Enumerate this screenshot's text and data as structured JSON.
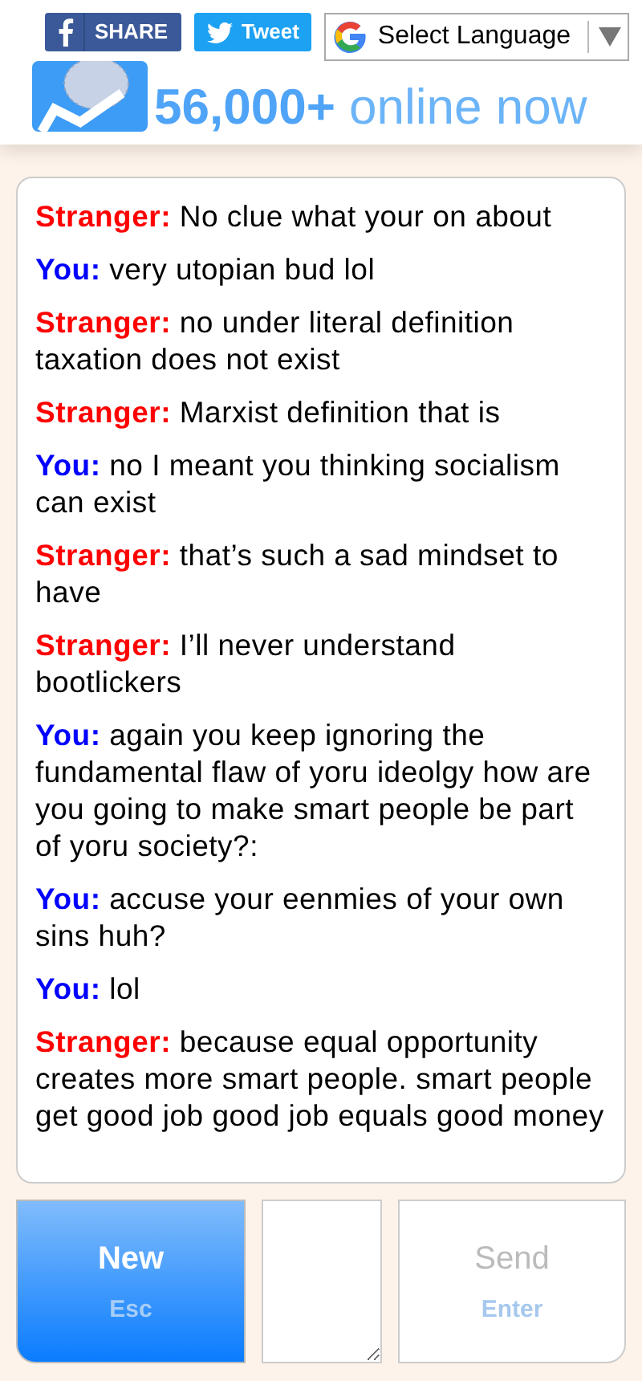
{
  "header": {
    "share_buttons": [
      {
        "kind": "facebook",
        "label": "SHARE"
      },
      {
        "kind": "twitter",
        "label": "Tweet"
      }
    ],
    "language_select": {
      "value": "Select Language"
    },
    "online_count": {
      "count": "56,000+",
      "label": "online now"
    }
  },
  "messages": [
    {
      "kind": "stranger",
      "speaker": "Stranger:",
      "text": "No clue what your on about"
    },
    {
      "kind": "you",
      "speaker": "You:",
      "text": "very utopian bud lol"
    },
    {
      "kind": "stranger",
      "speaker": "Stranger:",
      "text": "no under literal definition taxation does not exist"
    },
    {
      "kind": "stranger",
      "speaker": "Stranger:",
      "text": "Marxist definition that is"
    },
    {
      "kind": "you",
      "speaker": "You:",
      "text": "no I meant you thinking socialism can exist"
    },
    {
      "kind": "stranger",
      "speaker": "Stranger:",
      "text": "that’s such a sad mindset to have"
    },
    {
      "kind": "stranger",
      "speaker": "Stranger:",
      "text": "I’ll never understand bootlickers"
    },
    {
      "kind": "you",
      "speaker": "You:",
      "text": "again you keep ignoring the fundamental flaw of yoru ideolgy how are you going to make smart people be part of yoru society?:"
    },
    {
      "kind": "you",
      "speaker": "You:",
      "text": "accuse your eenmies of your own sins huh?"
    },
    {
      "kind": "you",
      "speaker": "You:",
      "text": "lol"
    },
    {
      "kind": "stranger",
      "speaker": "Stranger:",
      "text": "because equal opportunity creates more smart people. smart people get good job good job equals good money"
    }
  ],
  "controls": {
    "new_button": {
      "label": "New",
      "shortcut": "Esc"
    },
    "send_button": {
      "label": "Send",
      "shortcut": "Enter",
      "disabled": true
    }
  }
}
